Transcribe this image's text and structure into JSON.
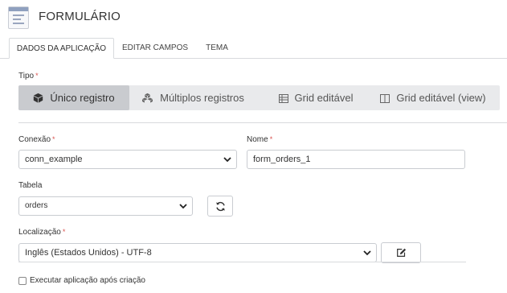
{
  "header": {
    "title": "FORMULÁRIO",
    "icon": "form-icon"
  },
  "tabs": [
    {
      "label": "DADOS DA APLICAÇÃO",
      "active": true
    },
    {
      "label": "EDITAR CAMPOS",
      "active": false
    },
    {
      "label": "TEMA",
      "active": false
    }
  ],
  "tipo": {
    "label": "Tipo",
    "options": [
      {
        "label": "Único registro",
        "icon": "cube-icon",
        "selected": true
      },
      {
        "label": "Múltiplos registros",
        "icon": "cubes-icon",
        "selected": false
      },
      {
        "label": "Grid editável",
        "icon": "table-icon",
        "selected": false
      },
      {
        "label": "Grid editável (view)",
        "icon": "columns-icon",
        "selected": false
      }
    ]
  },
  "conexao": {
    "label": "Conexão",
    "value": "conn_example"
  },
  "nome": {
    "label": "Nome",
    "value": "form_orders_1"
  },
  "tabela": {
    "label": "Tabela",
    "value": "orders",
    "refresh_icon": "refresh-icon"
  },
  "localizacao": {
    "label": "Localização",
    "value": "Inglês (Estados Unidos) - UTF-8",
    "edit_icon": "edit-icon"
  },
  "executar": {
    "label": "Executar aplicação após criação",
    "checked": false
  },
  "required_mark": "*"
}
